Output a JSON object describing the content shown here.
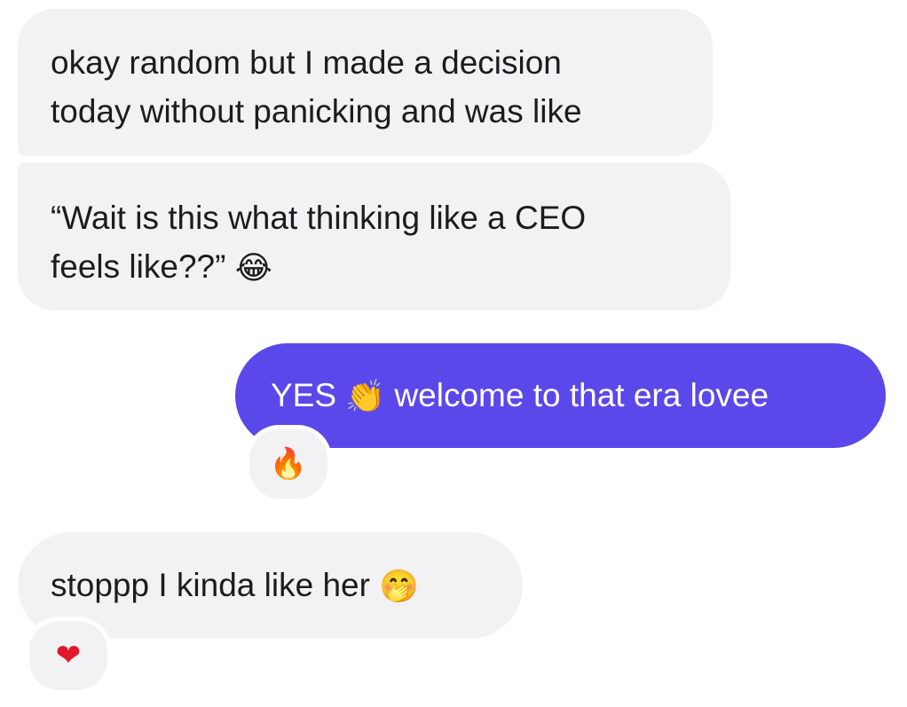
{
  "messages": [
    {
      "direction": "incoming",
      "lines": [
        "okay random but I made a decision",
        "today without panicking and was like"
      ]
    },
    {
      "direction": "incoming",
      "lines": [
        "“Wait  is this what thinking like a CEO",
        "feels like??”"
      ],
      "trailing_emoji": "laughing-tears-emoji"
    },
    {
      "direction": "outgoing",
      "text_before": "YES",
      "emoji": "clapping-hands-emoji",
      "text_after": "welcome to that era lovee",
      "reaction": "fire-emoji"
    },
    {
      "direction": "incoming",
      "text": "stoppp I kinda like her",
      "trailing_emoji": "hand-over-mouth-emoji",
      "reaction": "red-heart-emoji"
    }
  ],
  "colors": {
    "incoming_bubble": "#f2f2f5",
    "outgoing_bubble": "#5b48ea",
    "incoming_text": "#1c1c1e",
    "outgoing_text": "#ffffff"
  },
  "glyphs": {
    "laughing": "😂",
    "clap": "👏",
    "fire": "🔥",
    "hand_over_mouth": "🤭",
    "heart": "❤"
  }
}
